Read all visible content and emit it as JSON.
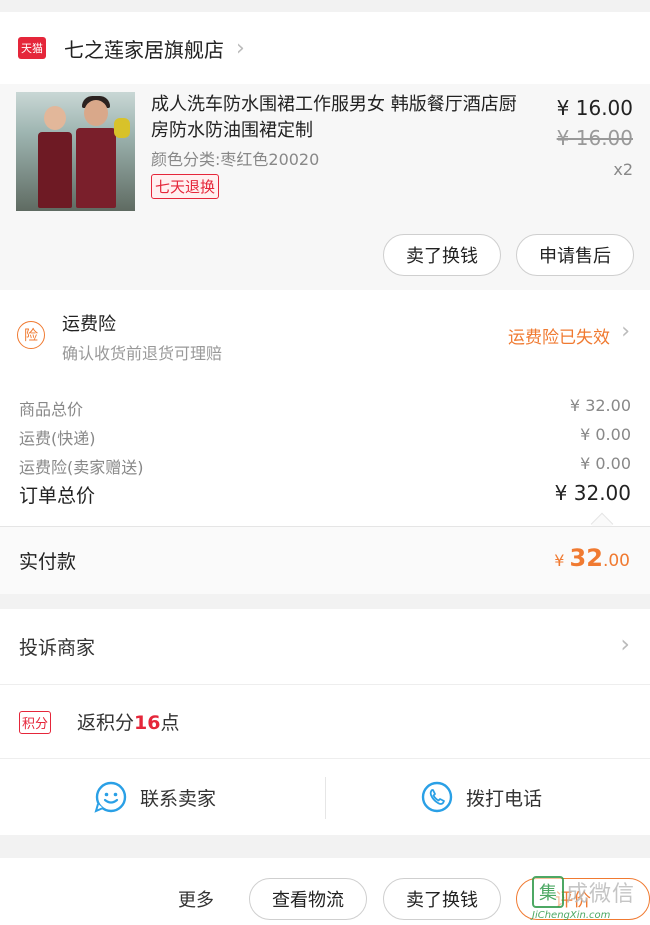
{
  "store": {
    "badge": "天猫",
    "name": "七之莲家居旗舰店",
    "chevron": "›"
  },
  "product": {
    "title": "成人洗车防水围裙工作服男女 韩版餐厅酒店厨房防水防油围裙定制",
    "attribute": "颜色分类:枣红色20020",
    "return_tag": "七天退换",
    "price": "¥ 16.00",
    "original_price": "¥ 16.00",
    "quantity": "x2",
    "actions": {
      "sell": "卖了换钱",
      "after_sale": "申请售后"
    }
  },
  "insurance": {
    "icon_label": "险",
    "title": "运费险",
    "description": "确认收货前退货可理赔",
    "status": "运费险已失效",
    "chevron": "›"
  },
  "pricing": {
    "rows": [
      {
        "label": "商品总价",
        "value": "¥ 32.00"
      },
      {
        "label": "运费(快递)",
        "value": "¥ 0.00"
      },
      {
        "label": "运费险(卖家赠送)",
        "value": "¥ 0.00"
      }
    ],
    "total_label": "订单总价",
    "total_value": "¥ 32.00"
  },
  "paid": {
    "label": "实付款",
    "currency": "¥ ",
    "integer": "32",
    "decimal": ".00"
  },
  "complain": {
    "label": "投诉商家",
    "chevron": "›"
  },
  "points": {
    "badge": "积分",
    "prefix": "返积分",
    "count": "16",
    "suffix": "点"
  },
  "contact": {
    "seller": "联系卖家",
    "phone": "拨打电话"
  },
  "bottom_bar": {
    "more": "更多",
    "logistics": "查看物流",
    "sell": "卖了换钱",
    "review": "评价"
  },
  "watermark": {
    "glyph": "集",
    "text": "成微信",
    "url": "JiChengXin.com"
  },
  "colors": {
    "accent_orange": "#f07a31",
    "tmall_red": "#e5263a",
    "contact_blue": "#2aa0e6"
  },
  "icons": [
    "tmall-logo-icon",
    "chevron-right-icon",
    "insurance-icon",
    "chat-face-icon",
    "phone-icon"
  ]
}
